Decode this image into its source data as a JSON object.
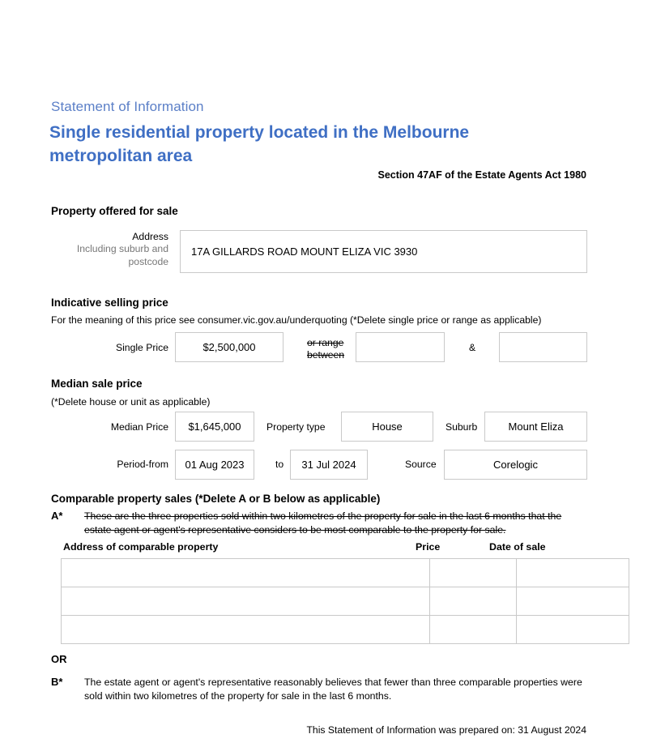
{
  "header": {
    "kicker": "Statement of Information",
    "title": "Single residential property located in the Melbourne metropolitan area",
    "act_reference": "Section 47AF of the Estate Agents Act 1980",
    "kicker_color": "#5b7fc7",
    "title_color": "#3f6fc4"
  },
  "property_offered": {
    "heading": "Property offered for sale",
    "address_label": "Address",
    "address_sublabel": "Including suburb and postcode",
    "address_value": "17A GILLARDS ROAD MOUNT ELIZA VIC 3930"
  },
  "indicative_price": {
    "heading": "Indicative selling price",
    "subtext": "For the meaning of this price see consumer.vic.gov.au/underquoting (*Delete single price or range as applicable)",
    "single_price_label": "Single Price",
    "single_price_value": "$2,500,000",
    "or_range_label_line1": "or range",
    "or_range_label_line2": "between",
    "range_low_value": "",
    "ampersand": "&",
    "range_high_value": ""
  },
  "median_price": {
    "heading": "Median sale price",
    "subtext": "(*Delete house or unit as applicable)",
    "median_price_label": "Median Price",
    "median_price_value": "$1,645,000",
    "property_type_label": "Property type",
    "property_type_value": "House",
    "suburb_label": "Suburb",
    "suburb_value": "Mount Eliza",
    "period_from_label": "Period-from",
    "period_from_value": "01 Aug 2023",
    "to_label": "to",
    "period_to_value": "31 Jul 2024",
    "source_label": "Source",
    "source_value": "Corelogic"
  },
  "comparable_sales": {
    "heading": "Comparable property sales (*Delete A or B below as applicable)",
    "option_a_marker": "A*",
    "option_a_text": "These are the three properties sold within two kilometres of the property for sale in the last 6 months that the estate agent or agent's representative considers to be most comparable to the property for sale.",
    "columns": [
      "Address of comparable property",
      "Price",
      "Date of sale"
    ],
    "rows": [
      {
        "address": "",
        "price": "",
        "date_of_sale": ""
      },
      {
        "address": "",
        "price": "",
        "date_of_sale": ""
      },
      {
        "address": "",
        "price": "",
        "date_of_sale": ""
      }
    ],
    "or_label": "OR",
    "option_b_marker": "B*",
    "option_b_text": "The estate agent or agent's representative reasonably believes that fewer than three comparable properties were sold within two kilometres of the property for sale in the last 6 months."
  },
  "footer": {
    "prepared_on": "This Statement of Information was prepared on: 31 August 2024"
  }
}
